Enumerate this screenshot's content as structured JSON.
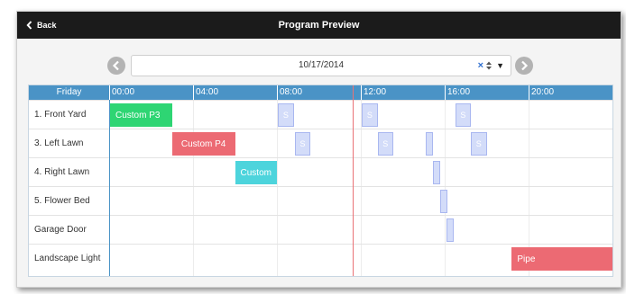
{
  "header": {
    "back_label": "Back",
    "title": "Program Preview"
  },
  "date_picker": {
    "value": "10/17/2014",
    "clear_glyph": "×",
    "dropdown_glyph": "▼"
  },
  "schedule": {
    "day_label": "Friday",
    "hours": [
      "00:00",
      "04:00",
      "08:00",
      "12:00",
      "16:00",
      "20:00"
    ],
    "hour_start": 0,
    "hour_end": 24,
    "now_hour": 11.6,
    "rows": [
      {
        "name": "1. Front Yard",
        "events": [
          {
            "label": "Custom P3",
            "start": 0.0,
            "end": 3.0,
            "kind": "custom-green"
          },
          {
            "label": "S",
            "start": 8.05,
            "end": 8.8,
            "kind": "s"
          },
          {
            "label": "S",
            "start": 12.05,
            "end": 12.8,
            "kind": "s"
          },
          {
            "label": "S",
            "start": 16.5,
            "end": 17.25,
            "kind": "s"
          }
        ]
      },
      {
        "name": "3. Left Lawn",
        "events": [
          {
            "label": "Custom P4",
            "start": 3.0,
            "end": 6.0,
            "kind": "custom-red"
          },
          {
            "label": "S",
            "start": 8.85,
            "end": 9.6,
            "kind": "s"
          },
          {
            "label": "S",
            "start": 12.8,
            "end": 13.55,
            "kind": "s"
          },
          {
            "label": "",
            "start": 15.1,
            "end": 15.45,
            "kind": "s"
          },
          {
            "label": "S",
            "start": 17.25,
            "end": 18.0,
            "kind": "s"
          }
        ]
      },
      {
        "name": "4. Right Lawn",
        "events": [
          {
            "label": "Custom",
            "start": 6.0,
            "end": 8.0,
            "kind": "custom-cyan"
          },
          {
            "label": "",
            "start": 15.45,
            "end": 15.8,
            "kind": "s"
          }
        ]
      },
      {
        "name": "5. Flower Bed",
        "events": [
          {
            "label": "",
            "start": 15.8,
            "end": 16.15,
            "kind": "s"
          }
        ]
      },
      {
        "name": "Garage Door",
        "events": [
          {
            "label": "",
            "start": 16.1,
            "end": 16.45,
            "kind": "s"
          }
        ]
      },
      {
        "name": "Landscape Light",
        "events": [
          {
            "label": "Pipe",
            "start": 19.2,
            "end": 24.0,
            "kind": "pipe"
          }
        ]
      }
    ]
  }
}
